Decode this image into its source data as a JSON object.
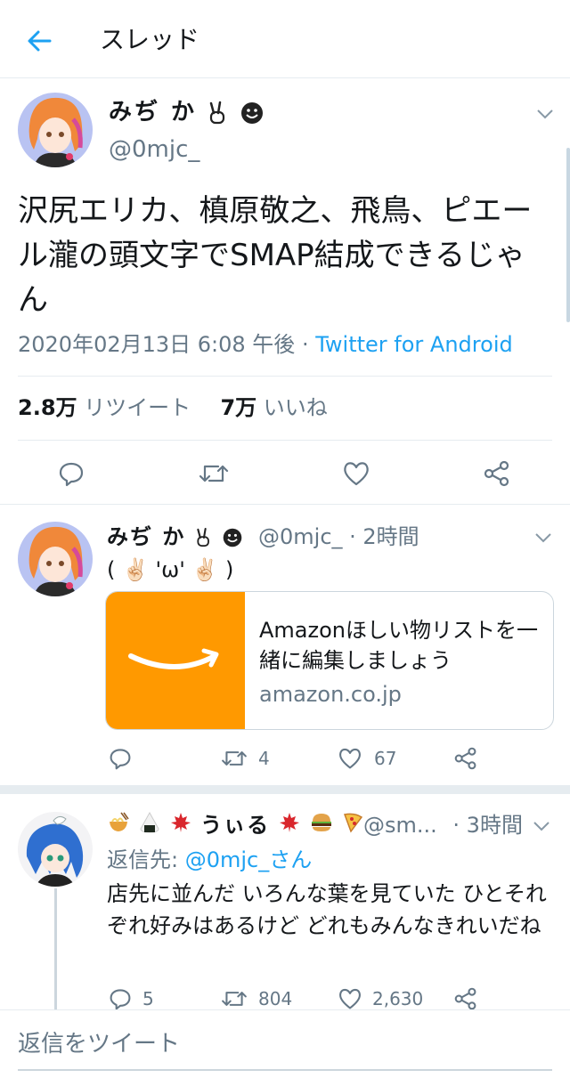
{
  "header": {
    "title": "スレッド"
  },
  "main_tweet": {
    "name": "みぢ か",
    "handle": "@0mjc_",
    "text": "沢尻エリカ、槙原敬之、飛鳥、ピエール瀧の頭文字でSMAP結成できるじゃん",
    "timestamp": "2020年02月13日 6:08 午後",
    "separator": "·",
    "source": "Twitter for Android",
    "retweet_count": "2.8万",
    "retweet_label": "リツイート",
    "like_count": "7万",
    "like_label": "いいね"
  },
  "reply1": {
    "name": "みぢ か",
    "handle": "@0mjc_",
    "time": "· 2時間",
    "text": "( ✌🏻 'ω' ✌🏻 )",
    "card": {
      "title": "Amazonほしい物リストを一緒に編集しましょう",
      "domain": "amazon.co.jp"
    },
    "retweets": "4",
    "likes": "67"
  },
  "reply2": {
    "name": "うぃる",
    "handle": "@sm...",
    "time": "· 3時間",
    "reply_to_label": "返信先:",
    "reply_to": "@0mjc_さん",
    "text": "店先に並んだ いろんな葉を見ていた ひとそれぞれ好みはあるけど どれもみんなきれいだね",
    "replies": "5",
    "retweets": "804",
    "likes": "2,630"
  },
  "compose": {
    "placeholder": "返信をツイート"
  },
  "colors": {
    "accent": "#1da1f2",
    "muted": "#657786",
    "amazon": "#ff9900"
  }
}
